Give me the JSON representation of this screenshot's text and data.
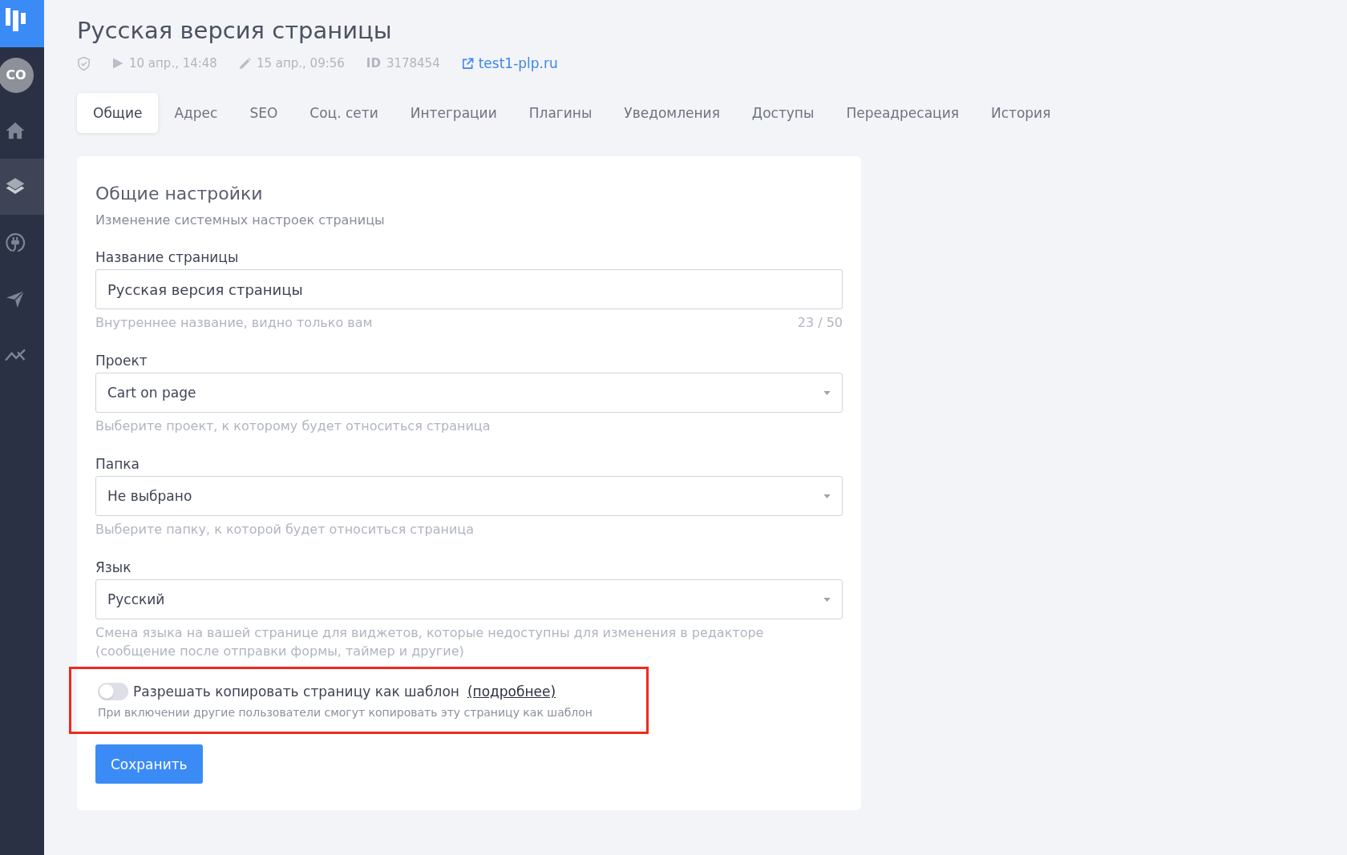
{
  "sidebar": {
    "avatar": "CO",
    "items": [
      {
        "kind": "home",
        "selected": false
      },
      {
        "kind": "layers",
        "selected": true
      },
      {
        "kind": "plug",
        "selected": false
      },
      {
        "kind": "send",
        "selected": false
      },
      {
        "kind": "chart",
        "selected": false
      }
    ]
  },
  "header": {
    "title": "Русская версия страницы",
    "meta": {
      "published": "10 апр., 14:48",
      "edited": "15 апр., 09:56",
      "id_label": "ID",
      "id": "3178454",
      "link": "test1-plp.ru"
    }
  },
  "tabs": [
    {
      "label": "Общие",
      "selected": true
    },
    {
      "label": "Адрес",
      "selected": false
    },
    {
      "label": "SEO",
      "selected": false
    },
    {
      "label": "Соц. сети",
      "selected": false
    },
    {
      "label": "Интеграции",
      "selected": false
    },
    {
      "label": "Плагины",
      "selected": false
    },
    {
      "label": "Уведомления",
      "selected": false
    },
    {
      "label": "Доступы",
      "selected": false
    },
    {
      "label": "Переадресация",
      "selected": false
    },
    {
      "label": "История",
      "selected": false
    }
  ],
  "settings": {
    "title": "Общие настройки",
    "subtitle": "Изменение системных настроек страницы",
    "fields": [
      {
        "kind": "text",
        "label": "Название страницы",
        "value": "Русская версия страницы",
        "hint": "Внутреннее название, видно только вам",
        "counter": "23 / 50"
      },
      {
        "kind": "select",
        "label": "Проект",
        "value": "Cart on page",
        "hint": "Выберите проект, к которому будет относиться страница"
      },
      {
        "kind": "select",
        "label": "Папка",
        "value": "Не выбрано",
        "hint": "Выберите папку, к которой будет относиться страница"
      },
      {
        "kind": "select",
        "label": "Язык",
        "value": "Русский",
        "hint": "Смена языка на вашей странице для виджетов, которые недоступны для изменения в редакторе (сообщение после отправки формы, таймер и другие)"
      }
    ],
    "template_option": {
      "on": false,
      "highlighted": true,
      "label": "Разрешать копировать страницу как шаблон",
      "link": "(подробнее)",
      "hint": "При включении другие пользователи смогут копировать эту страницу как шаблон"
    },
    "save_button": "Сохранить"
  }
}
